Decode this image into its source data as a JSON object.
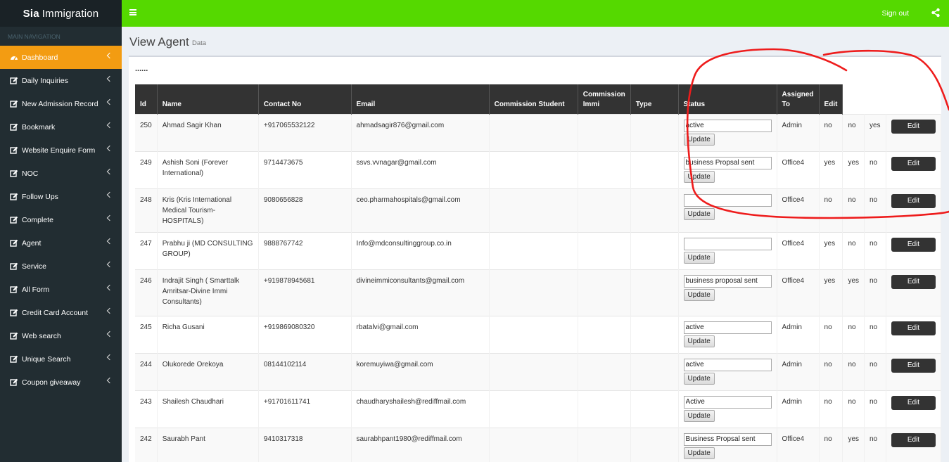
{
  "app": {
    "logo_bold": "Sia",
    "logo_rest": "Immigration"
  },
  "topbar": {
    "signout": "Sign out"
  },
  "sidebar": {
    "header": "MAIN NAVIGATION",
    "items": [
      {
        "label": "Dashboard",
        "icon": "dashboard-icon"
      },
      {
        "label": "Daily Inquiries",
        "icon": "edit-icon"
      },
      {
        "label": "New Admission Record",
        "icon": "edit-icon"
      },
      {
        "label": "Bookmark",
        "icon": "edit-icon"
      },
      {
        "label": "Website Enquire Form",
        "icon": "edit-icon"
      },
      {
        "label": "NOC",
        "icon": "edit-icon"
      },
      {
        "label": "Follow Ups",
        "icon": "edit-icon"
      },
      {
        "label": "Complete",
        "icon": "edit-icon"
      },
      {
        "label": "Agent",
        "icon": "edit-icon"
      },
      {
        "label": "Service",
        "icon": "edit-icon"
      },
      {
        "label": "All Form",
        "icon": "edit-icon"
      },
      {
        "label": "Credit Card Account",
        "icon": "edit-icon"
      },
      {
        "label": "Web search",
        "icon": "edit-icon"
      },
      {
        "label": "Unique Search",
        "icon": "edit-icon"
      },
      {
        "label": "Coupon giveaway",
        "icon": "edit-icon"
      }
    ]
  },
  "page": {
    "title": "View Agent",
    "subtitle": "Data",
    "dots": "......"
  },
  "table": {
    "headers": [
      "Id",
      "Name",
      "Contact No",
      "Email",
      "Commission Student",
      "Commission Immi",
      "Type",
      "Status",
      "Assigned To",
      "Edit"
    ],
    "update_label": "Update",
    "edit_label": "Edit",
    "rows": [
      {
        "id": "250",
        "name": "Ahmad Sagir Khan",
        "contact": "+917065532122",
        "email": "ahmadsagir876@gmail.com",
        "status": "active",
        "assigned": "Admin",
        "c1": "no",
        "c2": "no",
        "c3": "yes"
      },
      {
        "id": "249",
        "name": "Ashish Soni (Forever International)",
        "contact": "9714473675",
        "email": "ssvs.vvnagar@gmail.com",
        "status": "business Propsal sent",
        "assigned": "Office4",
        "c1": "yes",
        "c2": "yes",
        "c3": "no"
      },
      {
        "id": "248",
        "name": "Kris (Kris International Medical Tourism-HOSPITALS)",
        "contact": "9080656828",
        "email": "ceo.pharmahospitals@gmail.com",
        "status": "",
        "assigned": "Office4",
        "c1": "no",
        "c2": "no",
        "c3": "no"
      },
      {
        "id": "247",
        "name": "Prabhu ji (MD CONSULTING GROUP)",
        "contact": "9888767742",
        "email": "Info@mdconsultinggroup.co.in",
        "status": "",
        "assigned": "Office4",
        "c1": "yes",
        "c2": "no",
        "c3": "no"
      },
      {
        "id": "246",
        "name": "Indrajit Singh ( Smarttalk Amritsar-Divine Immi Consultants)",
        "contact": "+919878945681",
        "email": "divineimmiconsultants@gmail.com",
        "status": "business proposal sent",
        "assigned": "Office4",
        "c1": "yes",
        "c2": "yes",
        "c3": "no",
        "tall": true
      },
      {
        "id": "245",
        "name": "Richa Gusani",
        "contact": "+919869080320",
        "email": "rbatalvi@gmail.com",
        "status": "active",
        "assigned": "Admin",
        "c1": "no",
        "c2": "no",
        "c3": "no"
      },
      {
        "id": "244",
        "name": "Olukorede Orekoya",
        "contact": "08144102114",
        "email": "koremuyiwa@gmail.com",
        "status": "active",
        "assigned": "Admin",
        "c1": "no",
        "c2": "no",
        "c3": "no"
      },
      {
        "id": "243",
        "name": "Shailesh Chaudhari",
        "contact": "+91701611741",
        "email": "chaudharyshailesh@rediffmail.com",
        "status": "Active",
        "assigned": "Admin",
        "c1": "no",
        "c2": "no",
        "c3": "no"
      },
      {
        "id": "242",
        "name": "Saurabh Pant",
        "contact": "9410317318",
        "email": "saurabhpant1980@rediffmail.com",
        "status": "Business Propsal sent",
        "assigned": "Office4",
        "c1": "no",
        "c2": "yes",
        "c3": "no"
      }
    ]
  },
  "colors": {
    "topbar": "#55d900",
    "sidebar": "#222d32",
    "active_nav": "#f39c12",
    "annotation": "#ee1c1c"
  }
}
